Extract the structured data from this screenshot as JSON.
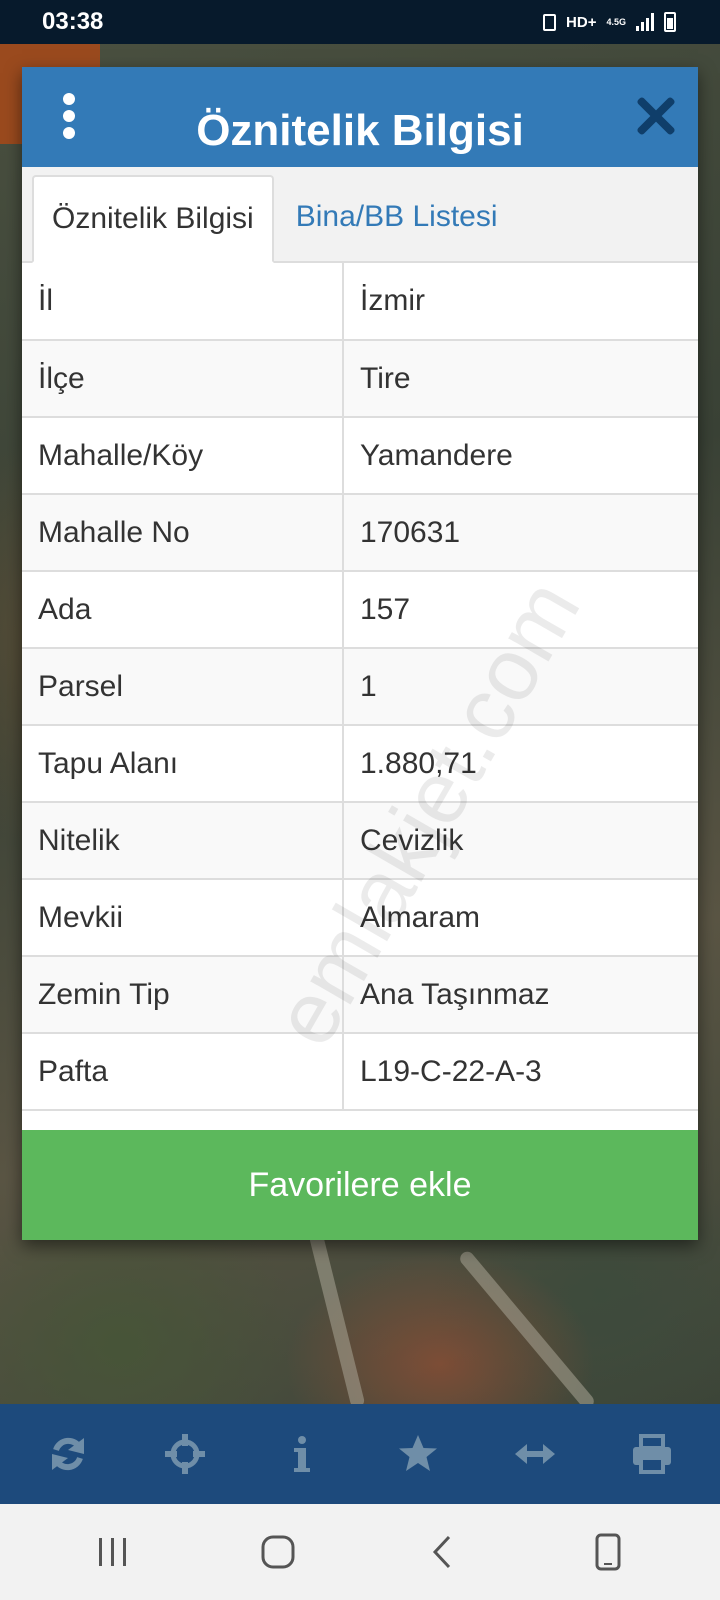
{
  "status_bar": {
    "time": "03:38",
    "network": "HD+",
    "network_sub": "4.5G"
  },
  "dialog": {
    "title": "Öznitelik Bilgisi",
    "tabs": [
      {
        "label": "Öznitelik Bilgisi",
        "active": true
      },
      {
        "label": "Bina/BB Listesi",
        "active": false
      }
    ],
    "rows": [
      {
        "key": "İl",
        "value": "İzmir"
      },
      {
        "key": "İlçe",
        "value": "Tire"
      },
      {
        "key": "Mahalle/Köy",
        "value": "Yamandere"
      },
      {
        "key": "Mahalle No",
        "value": "170631"
      },
      {
        "key": "Ada",
        "value": "157"
      },
      {
        "key": "Parsel",
        "value": "1"
      },
      {
        "key": "Tapu Alanı",
        "value": "1.880,71"
      },
      {
        "key": "Nitelik",
        "value": "Cevizlik"
      },
      {
        "key": "Mevkii",
        "value": "Almaram"
      },
      {
        "key": "Zemin Tip",
        "value": "Ana Taşınmaz"
      },
      {
        "key": "Pafta",
        "value": "L19-C-22-A-3"
      }
    ],
    "favorite_button": "Favorilere ekle"
  },
  "watermark": "emlakjet.com",
  "toolbar": {
    "icons": [
      "refresh-icon",
      "crosshair-icon",
      "info-icon",
      "star-icon",
      "measure-icon",
      "print-icon"
    ]
  },
  "colors": {
    "header": "#337ab7",
    "button": "#5cb85c",
    "toolbar": "#1d4a7c",
    "status_bar": "#071a2c"
  }
}
